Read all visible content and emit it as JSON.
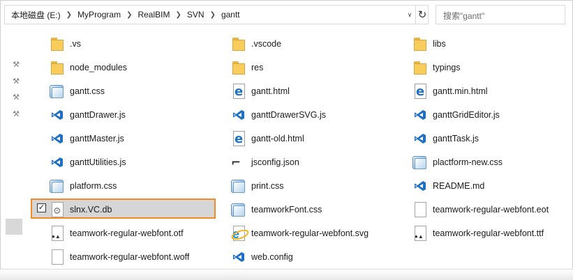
{
  "address_bar": {
    "crumbs": [
      "本地磁盘 (E:)",
      "MyProgram",
      "RealBIM",
      "SVN",
      "gantt"
    ]
  },
  "search": {
    "placeholder": "搜索\"gantt\""
  },
  "files": [
    {
      "name": ".vs",
      "icon": "folder-icon"
    },
    {
      "name": ".vscode",
      "icon": "folder-icon"
    },
    {
      "name": "libs",
      "icon": "folder-icon"
    },
    {
      "name": "node_modules",
      "icon": "folder-icon"
    },
    {
      "name": "res",
      "icon": "folder-icon"
    },
    {
      "name": "typings",
      "icon": "folder-icon"
    },
    {
      "name": "gantt.css",
      "icon": "css-file-icon"
    },
    {
      "name": "gantt.html",
      "icon": "html-file-icon"
    },
    {
      "name": "gantt.min.html",
      "icon": "html-file-icon"
    },
    {
      "name": "ganttDrawer.js",
      "icon": "vscode-file-icon"
    },
    {
      "name": "ganttDrawerSVG.js",
      "icon": "vscode-file-icon"
    },
    {
      "name": "ganttGridEditor.js",
      "icon": "vscode-file-icon"
    },
    {
      "name": "ganttMaster.js",
      "icon": "vscode-file-icon"
    },
    {
      "name": "gantt-old.html",
      "icon": "html-file-icon"
    },
    {
      "name": "ganttTask.js",
      "icon": "vscode-file-icon"
    },
    {
      "name": "ganttUtilities.js",
      "icon": "vscode-file-icon"
    },
    {
      "name": "jsconfig.json",
      "icon": "json-file-icon"
    },
    {
      "name": "plactform-new.css",
      "icon": "css-file-icon"
    },
    {
      "name": "platform.css",
      "icon": "css-file-icon"
    },
    {
      "name": "print.css",
      "icon": "css-file-icon"
    },
    {
      "name": "README.md",
      "icon": "vscode-file-icon"
    },
    {
      "name": "slnx.VC.db",
      "icon": "db-file-icon",
      "selected": true
    },
    {
      "name": "teamworkFont.css",
      "icon": "css-file-icon"
    },
    {
      "name": "teamwork-regular-webfont.eot",
      "icon": "blank-file-icon"
    },
    {
      "name": "teamwork-regular-webfont.otf",
      "icon": "font-file-icon"
    },
    {
      "name": "teamwork-regular-webfont.svg",
      "icon": "svg-file-icon"
    },
    {
      "name": "teamwork-regular-webfont.ttf",
      "icon": "font-file-icon"
    },
    {
      "name": "teamwork-regular-webfont.woff",
      "icon": "blank-file-icon"
    },
    {
      "name": "web.config",
      "icon": "vscode-file-icon"
    }
  ],
  "colors": {
    "selection_highlight": "#f08a24",
    "folder": "#f8cd5c",
    "vscode_blue": "#1f6fc2"
  }
}
